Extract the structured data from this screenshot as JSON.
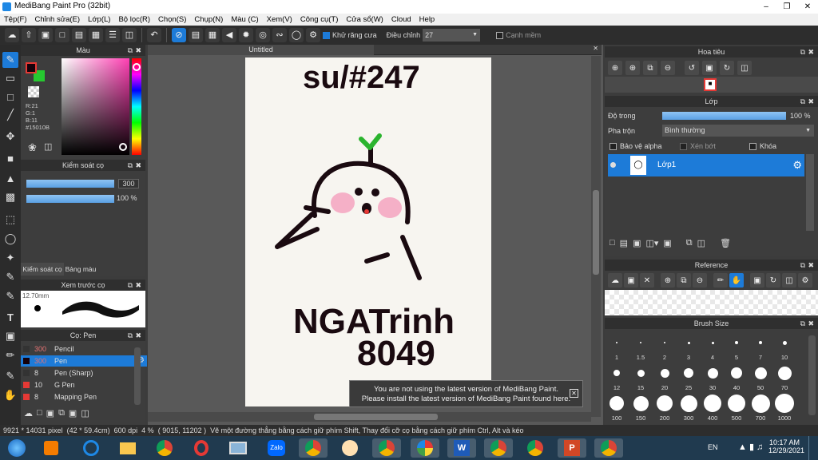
{
  "window": {
    "title": "MediBang Paint Pro (32bit)"
  },
  "menu": [
    "Tệp(F)",
    "Chỉnh sửa(E)",
    "Lớp(L)",
    "Bộ lọc(R)",
    "Chọn(S)",
    "Chụp(N)",
    "Màu (C)",
    "Xem(V)",
    "Công cụ(T)",
    "Cửa sổ(W)",
    "Cloud",
    "Help"
  ],
  "toolbar": {
    "antialias_label": "Khử răng cưa",
    "adjust_label": "Điều chỉnh",
    "adjust_value": "27",
    "sharp_edge_label": "Cạnh mềm"
  },
  "color_panel": {
    "title": "Màu",
    "r": "R:21",
    "g": "G:1",
    "b": "B:11",
    "hex": "#15010B",
    "foreground": "#15010b",
    "background": "#26c930"
  },
  "brush_control": {
    "title": "Kiểm soát cọ",
    "size": "300",
    "opacity": "100 %",
    "tab1": "Kiểm soát cọ",
    "tab2": "Bảng màu"
  },
  "preview": {
    "title": "Xem trước cọ",
    "size": "12.70mm"
  },
  "brush_list": {
    "title": "Cọ: Pen",
    "items": [
      {
        "size": "300",
        "name": "Pencil",
        "color": "#333333"
      },
      {
        "size": "300",
        "name": "Pen",
        "color": "#15010b"
      },
      {
        "size": "8",
        "name": "Pen (Sharp)",
        "color": "#333333"
      },
      {
        "size": "10",
        "name": "G Pen",
        "color": "#e53935"
      },
      {
        "size": "8",
        "name": "Mapping Pen",
        "color": "#e53935"
      }
    ]
  },
  "canvas": {
    "tab_title": "Untitled"
  },
  "drawing_text": {
    "line1": "su/#247",
    "line2": "NGATrinh",
    "line3": "8049"
  },
  "notice": {
    "line1": "You are not using the latest version of MediBang Paint.",
    "line2": "Please install the latest version of MediBang Paint found here."
  },
  "navigator": {
    "title": "Hoa tiêu"
  },
  "layer_panel": {
    "title": "Lớp",
    "opacity_label": "Độ trong",
    "opacity_value": "100 %",
    "blend_label": "Pha trộn",
    "blend_value": "Bình thường",
    "protect_alpha": "Bảo vệ alpha",
    "clipping": "Xén bớt",
    "lock": "Khóa",
    "layer_name": "Lớp1"
  },
  "reference": {
    "title": "Reference"
  },
  "brush_size": {
    "title": "Brush Size",
    "sizes": [
      "1",
      "1.5",
      "2",
      "3",
      "4",
      "5",
      "7",
      "10",
      "12",
      "15",
      "20",
      "25",
      "30",
      "40",
      "50",
      "70",
      "100",
      "150",
      "200",
      "300",
      "400",
      "500",
      "700",
      "1000"
    ]
  },
  "status": {
    "dimensions": "9921 * 14031 pixel",
    "physical": "(42 * 59.4cm)",
    "dpi": "600 dpi",
    "zoom": "4 %",
    "coords": "( 9015, 11202 )",
    "hint": "Vẽ một đường thẳng bằng cách giữ phím Shift, Thay đổi cỡ cọ bằng cách giữ phím Ctrl, Alt và kéo"
  },
  "taskbar": {
    "lang": "EN",
    "time": "10:17 AM",
    "date": "12/29/2021"
  }
}
